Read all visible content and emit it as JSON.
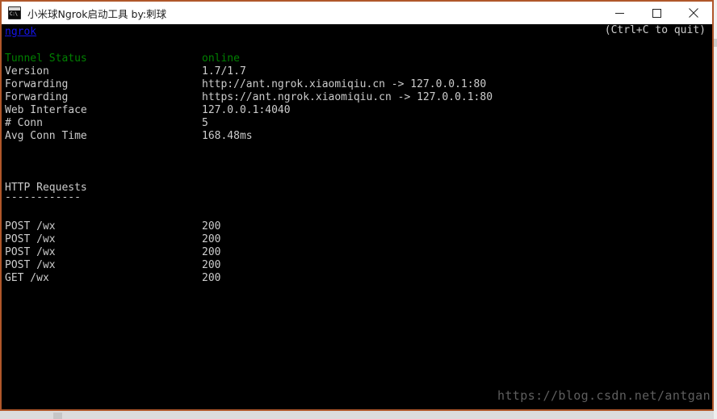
{
  "window": {
    "title": "小米球Ngrok启动工具 by:剌球",
    "icon": "console-window-icon",
    "icon_prompt": "C:\\",
    "border_color": "#b0572a",
    "controls": {
      "minimize": "−",
      "maximize": "□",
      "close": "✕"
    }
  },
  "console": {
    "background": "#000000",
    "link_label": "ngrok",
    "link_color": "#1414e8",
    "quit_hint": "(Ctrl+C to quit)",
    "accent_green": "#008000",
    "text_color": "#cccccc",
    "status_rows": [
      {
        "label": "Tunnel Status",
        "value": "online",
        "highlight": true
      },
      {
        "label": "Version",
        "value": "1.7/1.7",
        "highlight": false
      },
      {
        "label": "Forwarding",
        "value": "http://ant.ngrok.xiaomiqiu.cn -> 127.0.0.1:80",
        "highlight": false
      },
      {
        "label": "Forwarding",
        "value": "https://ant.ngrok.xiaomiqiu.cn -> 127.0.0.1:80",
        "highlight": false
      },
      {
        "label": "Web Interface",
        "value": "127.0.0.1:4040",
        "highlight": false
      },
      {
        "label": "# Conn",
        "value": "5",
        "highlight": false
      },
      {
        "label": "Avg Conn Time",
        "value": "168.48ms",
        "highlight": false
      }
    ],
    "requests_heading": "HTTP Requests",
    "requests_divider": "------------",
    "requests": [
      {
        "request": "POST /wx",
        "status": "200"
      },
      {
        "request": "POST /wx",
        "status": "200"
      },
      {
        "request": "POST /wx",
        "status": "200"
      },
      {
        "request": "POST /wx",
        "status": "200"
      },
      {
        "request": "GET /wx",
        "status": "200"
      }
    ],
    "watermark": "https://blog.csdn.net/antgan"
  }
}
